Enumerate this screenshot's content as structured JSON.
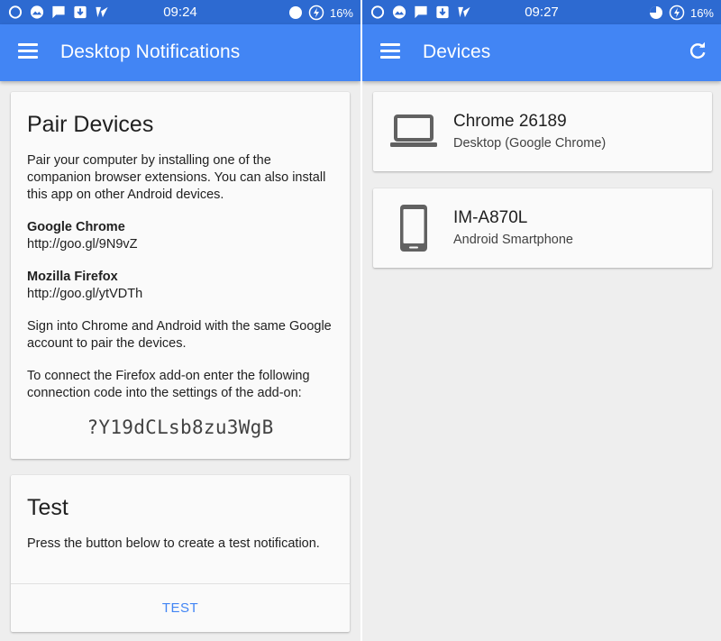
{
  "left_screen": {
    "status": {
      "time": "09:24",
      "battery": "16%"
    },
    "app_title": "Desktop Notifications",
    "pair_card": {
      "title": "Pair Devices",
      "intro": "Pair your computer by installing one of the companion browser extensions. You can also install this app on other Android devices.",
      "chrome_heading": "Google Chrome",
      "chrome_link": "http://goo.gl/9N9vZ",
      "firefox_heading": "Mozilla Firefox",
      "firefox_link": "http://goo.gl/ytVDTh",
      "signin_text": "Sign into Chrome and Android with the same Google account to pair the devices.",
      "connect_text": "To connect the Firefox add-on enter the following connection code into the settings of the add-on:",
      "connection_code": "?Y19dCLsb8zu3WgB"
    },
    "test_card": {
      "title": "Test",
      "description": "Press the button below to create a test notification.",
      "button_label": "TEST"
    }
  },
  "right_screen": {
    "status": {
      "time": "09:27",
      "battery": "16%"
    },
    "app_title": "Devices",
    "devices": [
      {
        "name": "Chrome 26189",
        "type": "Desktop (Google Chrome)",
        "icon": "laptop-icon"
      },
      {
        "name": "IM-A870L",
        "type": "Android Smartphone",
        "icon": "smartphone-icon"
      }
    ]
  },
  "colors": {
    "status_bar": "#2d6ad1",
    "app_bar": "#4285f4",
    "accent": "#4285f4",
    "background": "#eeeeee",
    "card": "#fafafa"
  }
}
